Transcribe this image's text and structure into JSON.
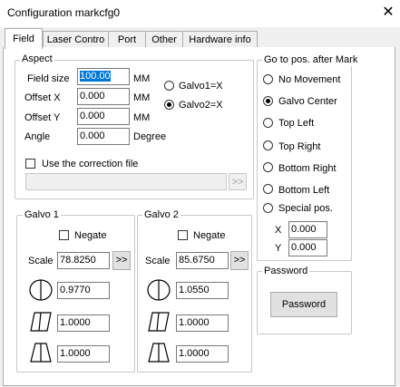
{
  "window": {
    "title": "Configuration markcfg0",
    "close_glyph": "✕"
  },
  "tabs": [
    {
      "label": "Field",
      "active": true
    },
    {
      "label": "Laser Contro"
    },
    {
      "label": "Port"
    },
    {
      "label": "Other"
    },
    {
      "label": "Hardware info"
    }
  ],
  "aspect": {
    "title": "Aspect",
    "field_size_label": "Field size",
    "field_size_value": "100.00",
    "offset_x_label": "Offset X",
    "offset_x_value": "0.000",
    "offset_y_label": "Offset Y",
    "offset_y_value": "0.000",
    "angle_label": "Angle",
    "angle_value": "0.000",
    "unit_mm": "MM",
    "unit_degree": "Degree",
    "galvo1_x_label": "Galvo1=X",
    "galvo2_x_label": "Galvo2=X",
    "galvo_selected": "Galvo2=X",
    "correction_label": "Use the correction file",
    "correction_checked": false,
    "correction_path": "",
    "browse_label": ">>"
  },
  "goto_pos": {
    "title": "Go to pos. after Mark",
    "options": [
      "No Movement",
      "Galvo Center",
      "Top Left",
      "Top Right",
      "Bottom Right",
      "Bottom Left",
      "Special pos."
    ],
    "selected": "Galvo Center",
    "x_label": "X",
    "x_value": "0.000",
    "y_label": "Y",
    "y_value": "0.000"
  },
  "galvo1": {
    "title": "Galvo 1",
    "negate_label": "Negate",
    "negate_checked": false,
    "scale_label": "Scale",
    "scale_value": "78.8250",
    "scale_button": ">>",
    "barrel_value": "0.9770",
    "parallelogram_value": "1.0000",
    "trapezoid_value": "1.0000"
  },
  "galvo2": {
    "title": "Galvo 2",
    "negate_label": "Negate",
    "negate_checked": false,
    "scale_label": "Scale",
    "scale_value": "85.6750",
    "scale_button": ">>",
    "barrel_value": "1.0550",
    "parallelogram_value": "1.0000",
    "trapezoid_value": "1.0000"
  },
  "password": {
    "title": "Password",
    "button_label": "Password"
  },
  "icons": {
    "barrel": "barrel-distortion-icon",
    "parallelogram": "parallelogram-distortion-icon",
    "trapezoid": "trapezoid-distortion-icon"
  }
}
